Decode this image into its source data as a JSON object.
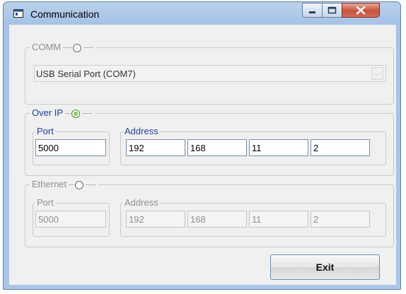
{
  "window": {
    "title": "Communication",
    "app_icon": "window-app-icon",
    "controls": [
      "minimize-icon",
      "maximize-icon",
      "close-icon"
    ]
  },
  "comm": {
    "label": "COMM",
    "selected": false,
    "port_value": "USB Serial Port (COM7)"
  },
  "over_ip": {
    "label": "Over IP",
    "selected": true,
    "port_label": "Port",
    "port_value": "5000",
    "address_label": "Address",
    "address": [
      "192",
      "168",
      "11",
      "2"
    ]
  },
  "ethernet": {
    "label": "Ethernet",
    "selected": false,
    "port_label": "Port",
    "port_value": "5000",
    "address_label": "Address",
    "address": [
      "192",
      "168",
      "11",
      "2"
    ]
  },
  "exit_button": "Exit",
  "colors": {
    "enabled_text": "#1e3f9c",
    "disabled_text": "#8f8f8f",
    "titlebar": "#a6c3e6",
    "close_button": "#c7503b"
  }
}
